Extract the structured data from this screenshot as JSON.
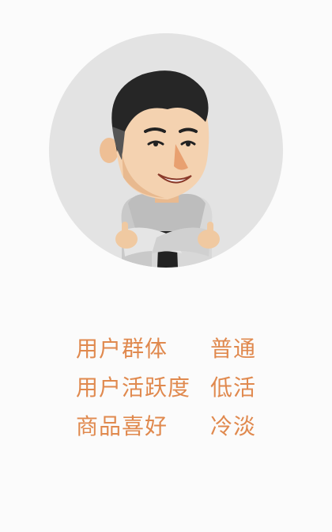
{
  "profile": {
    "avatar_icon": "cartoon-man-avatar",
    "colors": {
      "accent": "#e0894e",
      "avatar_bg": "#e3e3e3",
      "page_bg": "#fbfbfb"
    },
    "tags": [
      {
        "label": "用户群体",
        "value": "普通"
      },
      {
        "label": "用户活跃度",
        "value": "低活"
      },
      {
        "label": "商品喜好",
        "value": "冷淡"
      }
    ]
  }
}
